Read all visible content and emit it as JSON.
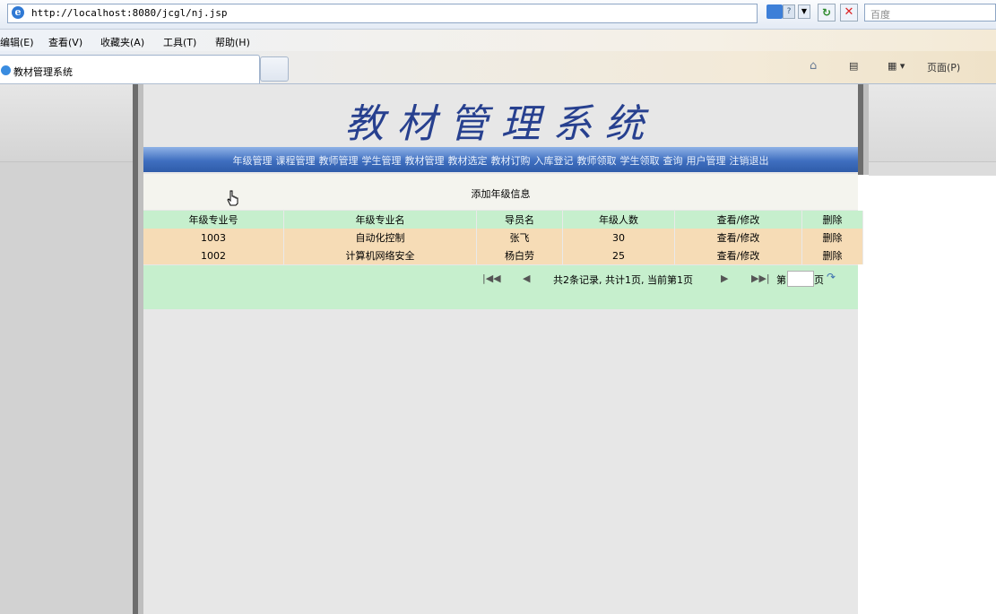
{
  "browser": {
    "url": "http://localhost:8080/jcgl/nj.jsp",
    "search_placeholder": "百度",
    "refresh_glyph": "↻",
    "stop_glyph": "✕",
    "menu": [
      "编辑(E)",
      "查看(V)",
      "收藏夹(A)",
      "工具(T)",
      "帮助(H)"
    ],
    "tab_title": "教材管理系统",
    "cmd_page": "页面(P)"
  },
  "site": {
    "title": "教材管理系统",
    "nav": [
      "年级管理",
      "课程管理",
      "教师管理",
      "学生管理",
      "教材管理",
      "教材选定",
      "教材订购",
      "入库登记",
      "教师领取",
      "学生领取",
      "查询",
      "用户管理",
      "注销退出"
    ]
  },
  "content": {
    "add_link": "添加年级信息",
    "columns": [
      "年级专业号",
      "年级专业名",
      "导员名",
      "年级人数",
      "查看/修改",
      "删除"
    ],
    "rows": [
      {
        "id": "1003",
        "name": "自动化控制",
        "counselor": "张飞",
        "count": "30",
        "view": "查看/修改",
        "delete": "删除"
      },
      {
        "id": "1002",
        "name": "计算机网络安全",
        "counselor": "杨白劳",
        "count": "25",
        "view": "查看/修改",
        "delete": "删除"
      }
    ]
  },
  "pager": {
    "first": "|◀◀",
    "prev": "◀",
    "info": "共2条记录, 共计1页, 当前第1页",
    "next": "▶",
    "last": "▶▶|",
    "page_prefix": "第",
    "page_suffix": "页",
    "go_icon": "↷"
  }
}
